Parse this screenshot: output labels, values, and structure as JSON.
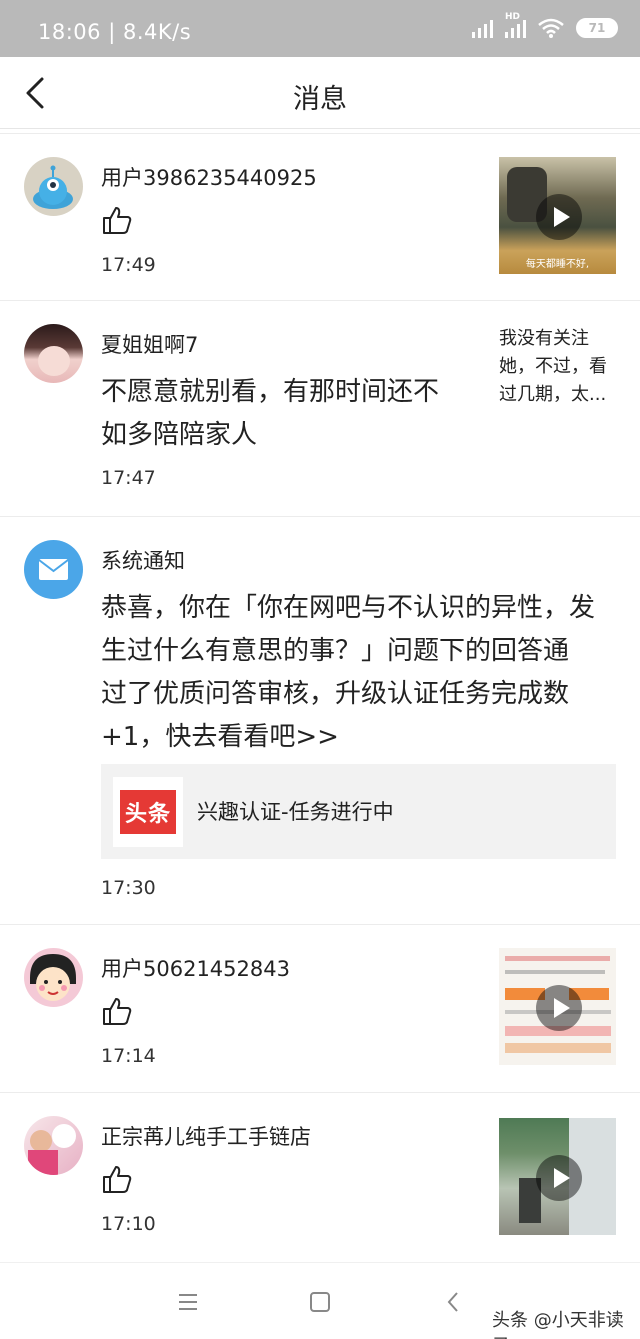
{
  "status_bar": {
    "time": "18:06",
    "speed": "8.4K/s",
    "battery": "71",
    "hd": "HD"
  },
  "header": {
    "title": "消息"
  },
  "messages": [
    {
      "user": "用户3986235440925",
      "time": "17:49",
      "thumb_caption": "每天都睡不好,"
    },
    {
      "user": "夏姐姐啊7",
      "text_line1": "不愿意就别看，有那时间还不",
      "text_line2": "如多陪陪家人",
      "time": "17:47",
      "snippet_line1": "我没有关注",
      "snippet_line2": "她，不过，看",
      "snippet_line3": "过几期，太..."
    },
    {
      "user": "系统通知",
      "text_line1": "恭喜，你在「你在网吧与不认识的异性，发",
      "text_line2": "生过什么有意思的事？」问题下的回答通",
      "text_line3": "过了优质问答审核，升级认证任务完成数",
      "text_line4": "+1，快去看看吧>>",
      "card_logo": "头条",
      "card_text": "兴趣认证-任务进行中",
      "time": "17:30"
    },
    {
      "user": "用户50621452843",
      "time": "17:14"
    },
    {
      "user": "正宗苒儿纯手工手链店",
      "time": "17:10"
    }
  ],
  "watermark": "头条 @小天非读录",
  "colors": {
    "status_bar": "#b9b9b9",
    "accent_blue": "#4ba6e8",
    "toutiao_red": "#e53935",
    "card_bg": "#f2f2f2"
  }
}
